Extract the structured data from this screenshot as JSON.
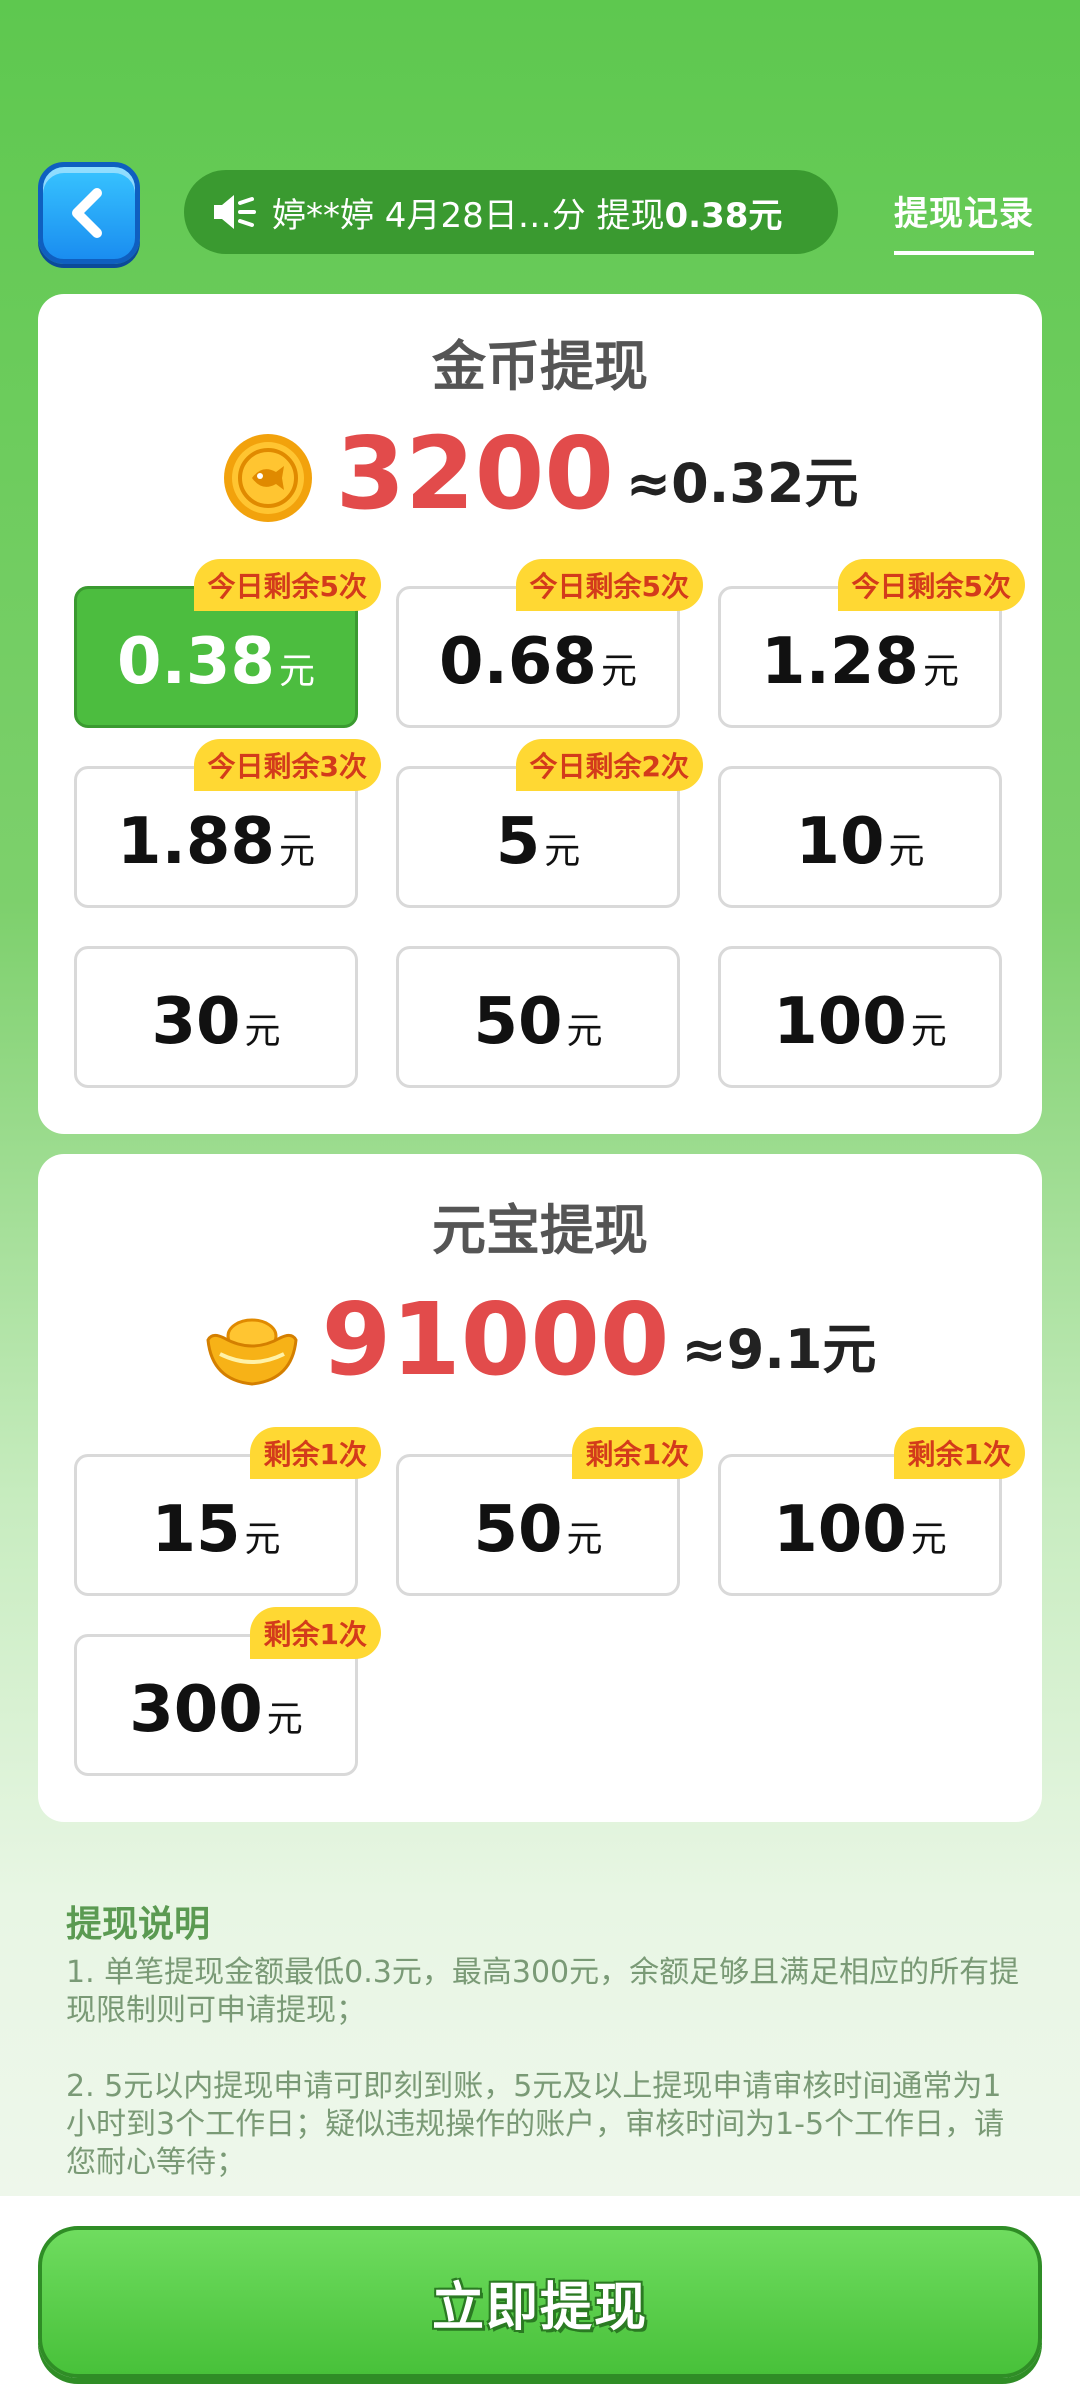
{
  "header": {
    "notice_text": "婷**婷 4月28日…分 提现",
    "notice_amount": "0.38元",
    "record_label": "提现记录"
  },
  "gold": {
    "title": "金币提现",
    "balance": "3200",
    "approx": "≈0.32元",
    "unit": "元",
    "options": [
      {
        "value": "0.38",
        "badge": "今日剩余5次",
        "selected": true
      },
      {
        "value": "0.68",
        "badge": "今日剩余5次"
      },
      {
        "value": "1.28",
        "badge": "今日剩余5次"
      },
      {
        "value": "1.88",
        "badge": "今日剩余3次"
      },
      {
        "value": "5",
        "badge": "今日剩余2次"
      },
      {
        "value": "10",
        "badge": ""
      },
      {
        "value": "30",
        "badge": ""
      },
      {
        "value": "50",
        "badge": ""
      },
      {
        "value": "100",
        "badge": ""
      }
    ]
  },
  "ingot": {
    "title": "元宝提现",
    "balance": "91000",
    "approx": "≈9.1元",
    "unit": "元",
    "options": [
      {
        "value": "15",
        "badge": "剩余1次"
      },
      {
        "value": "50",
        "badge": "剩余1次"
      },
      {
        "value": "100",
        "badge": "剩余1次"
      },
      {
        "value": "300",
        "badge": "剩余1次"
      }
    ]
  },
  "info": {
    "title": "提现说明",
    "items": [
      "1. 单笔提现金额最低0.3元，最高300元，余额足够且满足相应的所有提现限制则可申请提现；",
      "2. 5元以内提现申请可即刻到账，5元及以上提现申请审核时间通常为1小时到3个工作日；疑似违规操作的账户，审核时间为1-5个工作日，请您耐心等待；"
    ]
  },
  "button": {
    "label": "立即提现"
  },
  "colors": {
    "accent": "#4cbd3f",
    "badge_bg": "#ffd833",
    "balance": "#e24b4b"
  }
}
